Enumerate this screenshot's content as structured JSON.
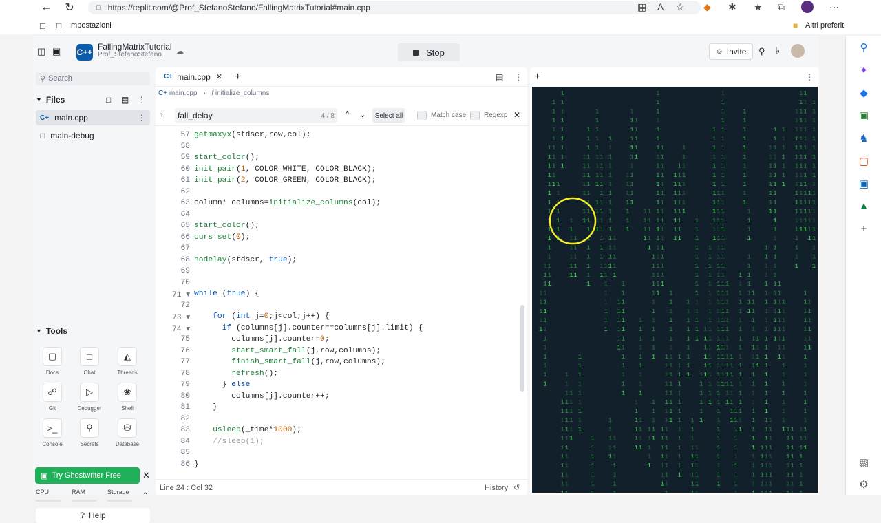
{
  "browser": {
    "url": "https://replit.com/@Prof_StefanoStefano/FallingMatrixTutorial#main.cpp",
    "bookmark": "Impostazioni",
    "other_bookmarks": "Altri preferiti"
  },
  "header": {
    "project_name": "FallingMatrixTutorial",
    "owner": "Prof_StefanoStefano",
    "logo_text": "C++",
    "stop_label": "Stop",
    "invite_label": "Invite"
  },
  "sidebar": {
    "search_placeholder": "Search",
    "files_title": "Files",
    "files": [
      {
        "name": "main.cpp"
      },
      {
        "name": "main-debug"
      }
    ],
    "tools_title": "Tools",
    "tools": [
      {
        "label": "Docs",
        "icon": "docs-icon"
      },
      {
        "label": "Chat",
        "icon": "chat-icon"
      },
      {
        "label": "Threads",
        "icon": "threads-icon"
      },
      {
        "label": "Git",
        "icon": "git-icon"
      },
      {
        "label": "Debugger",
        "icon": "debugger-icon"
      },
      {
        "label": "Shell",
        "icon": "shell-icon"
      },
      {
        "label": "Console",
        "icon": "console-icon"
      },
      {
        "label": "Secrets",
        "icon": "lock-icon"
      },
      {
        "label": "Database",
        "icon": "database-icon"
      }
    ],
    "ghostwriter_label": "Try Ghostwriter Free",
    "resources": [
      "CPU",
      "RAM",
      "Storage"
    ],
    "help_label": "Help"
  },
  "editor": {
    "tab_label": "main.cpp",
    "breadcrumb_file": "main.cpp",
    "breadcrumb_symbol": "initialize_columns",
    "find_value": "fall_delay",
    "find_count": "4 / 8",
    "select_all_label": "Select all",
    "match_case_label": "Match case",
    "regexp_label": "Regexp",
    "lines": [
      {
        "n": "57",
        "text": "getmaxyx(stdscr,row,col);"
      },
      {
        "n": "58",
        "text": ""
      },
      {
        "n": "59",
        "text": "start_color();"
      },
      {
        "n": "60",
        "text": "init_pair(1, COLOR_WHITE, COLOR_BLACK);"
      },
      {
        "n": "61",
        "text": "init_pair(2, COLOR_GREEN, COLOR_BLACK);"
      },
      {
        "n": "62",
        "text": ""
      },
      {
        "n": "63",
        "text": "column* columns=initialize_columns(col);"
      },
      {
        "n": "64",
        "text": ""
      },
      {
        "n": "65",
        "text": "start_color();"
      },
      {
        "n": "66",
        "text": "curs_set(0);"
      },
      {
        "n": "67",
        "text": ""
      },
      {
        "n": "68",
        "text": "nodelay(stdscr, true);"
      },
      {
        "n": "69",
        "text": ""
      },
      {
        "n": "70",
        "text": ""
      },
      {
        "n": "71",
        "text": "while (true) {",
        "fold": true
      },
      {
        "n": "72",
        "text": ""
      },
      {
        "n": "73",
        "text": "    for (int j=0;j<col;j++) {",
        "fold": true
      },
      {
        "n": "74",
        "text": "      if (columns[j].counter==columns[j].limit) {",
        "fold": true
      },
      {
        "n": "75",
        "text": "        columns[j].counter=0;"
      },
      {
        "n": "76",
        "text": "        start_smart_fall(j,row,columns);"
      },
      {
        "n": "77",
        "text": "        finish_smart_fall(j,row,columns);"
      },
      {
        "n": "78",
        "text": "        refresh();"
      },
      {
        "n": "79",
        "text": "      } else"
      },
      {
        "n": "80",
        "text": "        columns[j].counter++;"
      },
      {
        "n": "81",
        "text": "    }"
      },
      {
        "n": "82",
        "text": ""
      },
      {
        "n": "83",
        "text": "    usleep(_time*1000);"
      },
      {
        "n": "84",
        "text": "    //sleep(1);"
      },
      {
        "n": "85",
        "text": ""
      },
      {
        "n": "86",
        "text": "}"
      }
    ],
    "status_position": "Line 24 : Col 32",
    "history_label": "History"
  },
  "output": {
    "glyph": "1",
    "text_color": "#3fe04a",
    "background": "#12202b",
    "highlight_color": "#f4ee2a"
  }
}
